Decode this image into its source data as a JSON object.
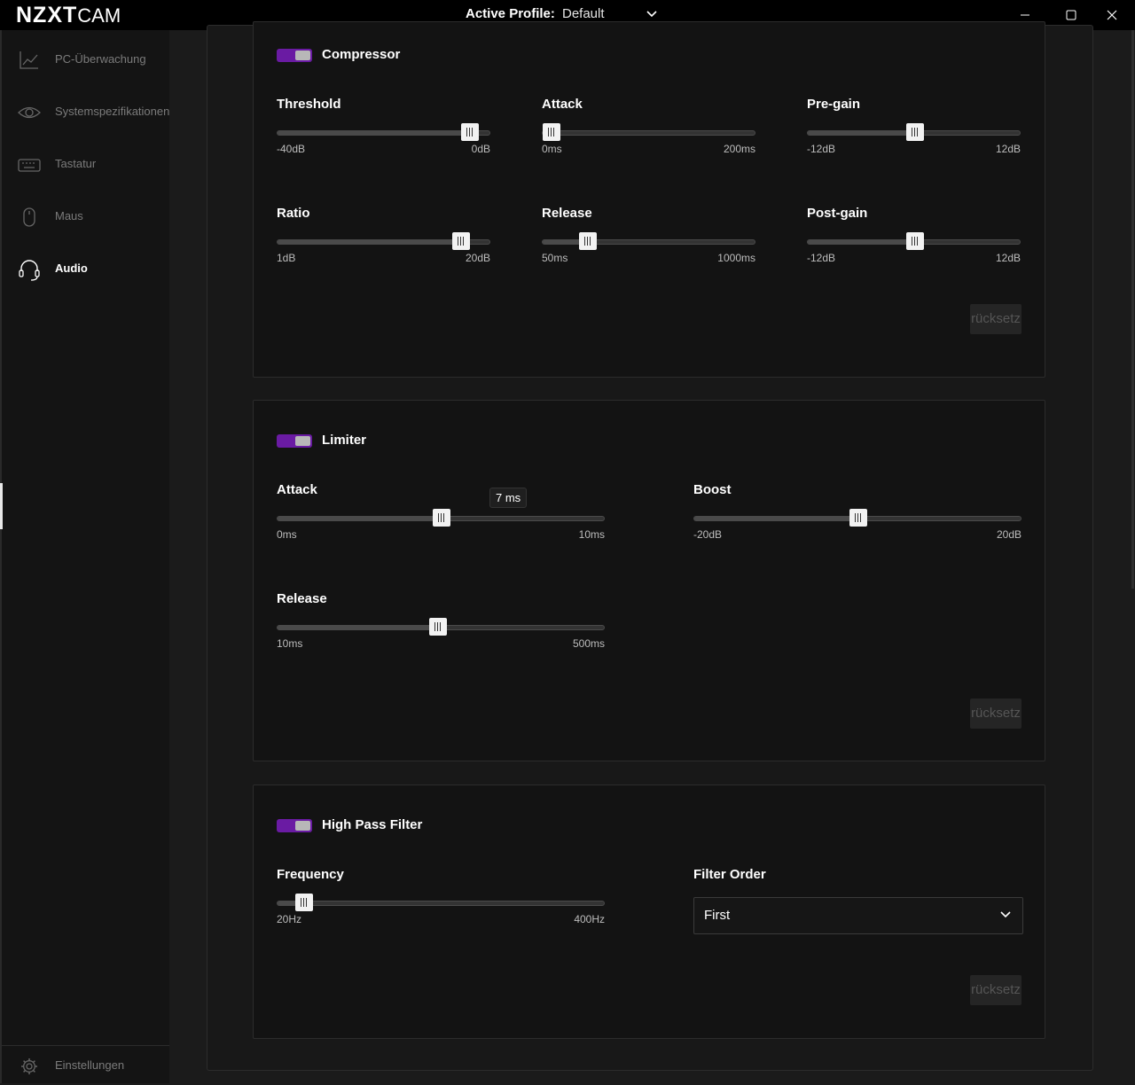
{
  "titlebar": {
    "logo_text": "NZXT",
    "logo_suffix": "CAM",
    "profile_label": "Active Profile:",
    "profile_value": "Default",
    "window_controls": [
      "minimize-icon",
      "maximize-icon",
      "close-icon"
    ]
  },
  "sidebar": {
    "items": [
      {
        "label": "PC-Überwachung",
        "icon": "chart-line-icon",
        "active": false
      },
      {
        "label": "Systemspezifikationen",
        "icon": "eye-icon",
        "active": false
      },
      {
        "label": "Tastatur",
        "icon": "keyboard-icon",
        "active": false
      },
      {
        "label": "Maus",
        "icon": "mouse-icon",
        "active": false
      },
      {
        "label": "Audio",
        "icon": "headset-icon",
        "active": true
      }
    ],
    "settings_label": "Einstellungen"
  },
  "compressor": {
    "title": "Compressor",
    "enabled": true,
    "params": [
      {
        "label": "Threshold",
        "min": "-40dB",
        "max": "0dB",
        "value_fraction": 0.9
      },
      {
        "label": "Attack",
        "min": "0ms",
        "max": "200ms",
        "value_fraction": 0.02
      },
      {
        "label": "Pre-gain",
        "min": "-12dB",
        "max": "12dB",
        "value_fraction": 0.5
      },
      {
        "label": "Ratio",
        "min": "1dB",
        "max": "20dB",
        "value_fraction": 0.86
      },
      {
        "label": "Release",
        "min": "50ms",
        "max": "1000ms",
        "value_fraction": 0.21
      },
      {
        "label": "Post-gain",
        "min": "-12dB",
        "max": "12dB",
        "value_fraction": 0.5
      }
    ],
    "reset_label": "rücksetz"
  },
  "limiter": {
    "title": "Limiter",
    "enabled": true,
    "params": [
      {
        "label": "Attack",
        "min": "0ms",
        "max": "10ms",
        "value_fraction": 0.5,
        "tooltip": "7 ms"
      },
      {
        "label": "Boost",
        "min": "-20dB",
        "max": "20dB",
        "value_fraction": 0.5
      },
      {
        "label": "Release",
        "min": "10ms",
        "max": "500ms",
        "value_fraction": 0.49
      }
    ],
    "reset_label": "rücksetz"
  },
  "highpass": {
    "title": "High Pass Filter",
    "enabled": true,
    "frequency": {
      "label": "Frequency",
      "min": "20Hz",
      "max": "400Hz",
      "value_fraction": 0.08
    },
    "filter_order": {
      "label": "Filter Order",
      "selected": "First"
    },
    "reset_label": "rücksetz"
  },
  "colors": {
    "accent": "#6a1ba3",
    "background": "#131313",
    "titlebar": "#000000"
  }
}
